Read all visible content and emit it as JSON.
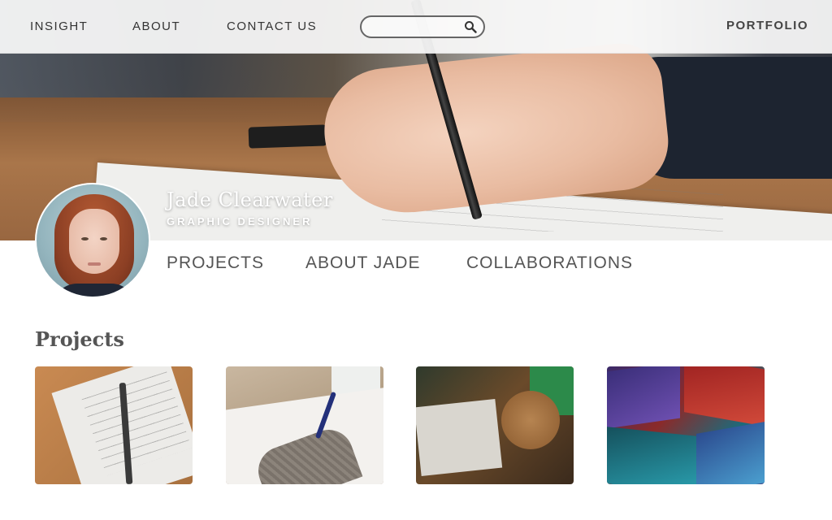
{
  "nav": {
    "links": [
      {
        "label": "INSIGHT"
      },
      {
        "label": "ABOUT"
      },
      {
        "label": "CONTACT US"
      }
    ],
    "search": {
      "placeholder": "",
      "value": ""
    },
    "brand": "PORTFOLIO"
  },
  "profile": {
    "name": "Jade Clearwater",
    "role": "GRAPHIC DESIGNER",
    "tabs": [
      {
        "label": "PROJECTS"
      },
      {
        "label": "ABOUT JADE"
      },
      {
        "label": "COLLABORATIONS"
      }
    ]
  },
  "projects": {
    "title": "Projects",
    "items": [
      {
        "image": "wireframe-sketch-photo"
      },
      {
        "image": "hand-writing-photo"
      },
      {
        "image": "typography-book-photo"
      },
      {
        "image": "paint-brushes-photo"
      }
    ]
  },
  "colors": {
    "nav_bg": "#fafafa",
    "text": "#555555",
    "hero_text": "#ffffff"
  }
}
